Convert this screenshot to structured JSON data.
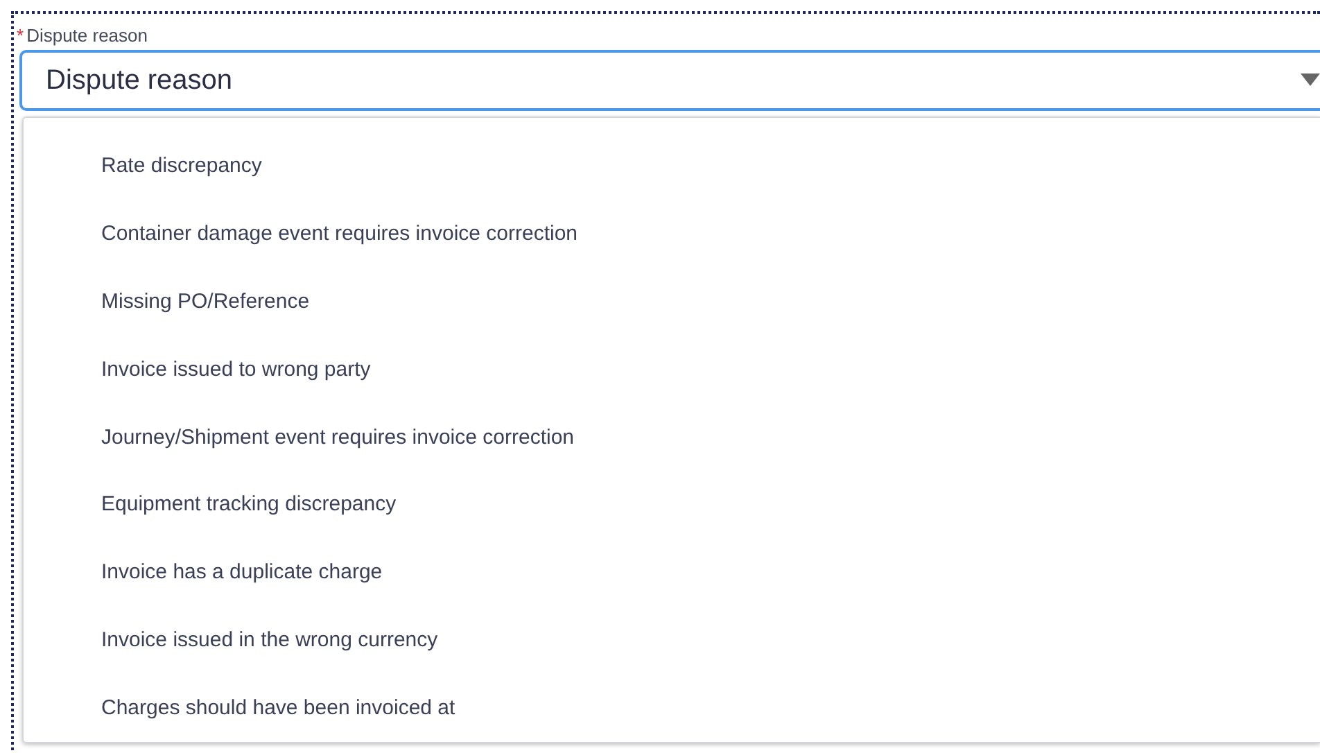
{
  "field": {
    "required_mark": "*",
    "label": "Dispute reason",
    "placeholder": "Dispute reason",
    "focused": true,
    "expanded": true
  },
  "options": [
    {
      "label": "Rate discrepancy"
    },
    {
      "label": "Container damage event requires invoice correction"
    },
    {
      "label": "Missing PO/Reference"
    },
    {
      "label": "Invoice issued to wrong party"
    },
    {
      "label": "Journey/Shipment event requires invoice correction"
    },
    {
      "label": "Equipment tracking discrepancy"
    },
    {
      "label": "Invoice has a duplicate charge"
    },
    {
      "label": "Invoice issued in the wrong currency"
    },
    {
      "label": "Charges should have been invoiced at"
    }
  ]
}
